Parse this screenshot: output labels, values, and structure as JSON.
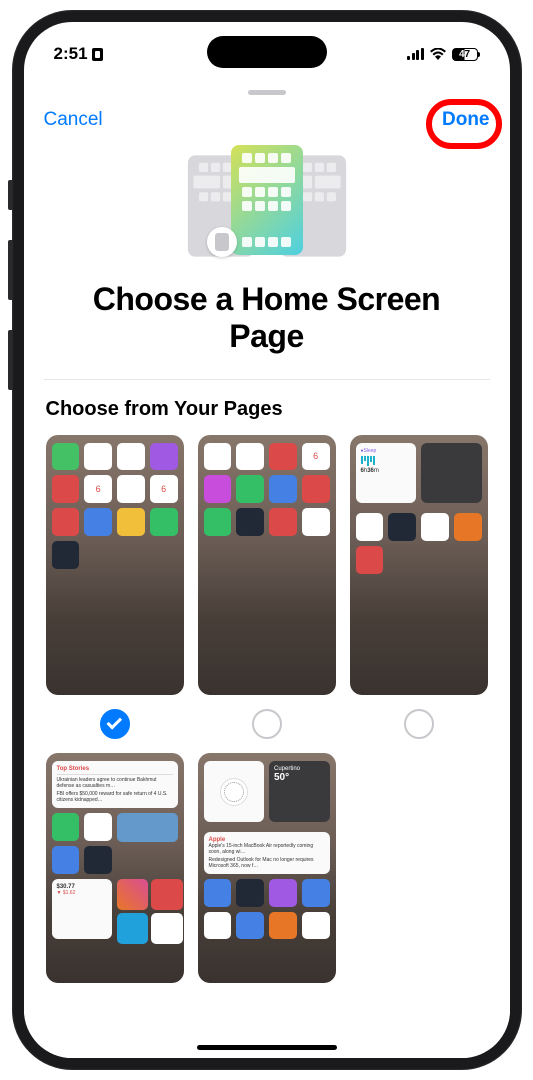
{
  "status_bar": {
    "time": "2:51",
    "battery_percent": "47"
  },
  "nav": {
    "cancel": "Cancel",
    "done": "Done"
  },
  "hero": {
    "title": "Choose a Home Screen Page"
  },
  "section": {
    "header": "Choose from Your Pages"
  },
  "pages": [
    {
      "selected": true
    },
    {
      "selected": false
    },
    {
      "selected": false
    },
    {
      "selected": false
    },
    {
      "selected": false
    }
  ]
}
